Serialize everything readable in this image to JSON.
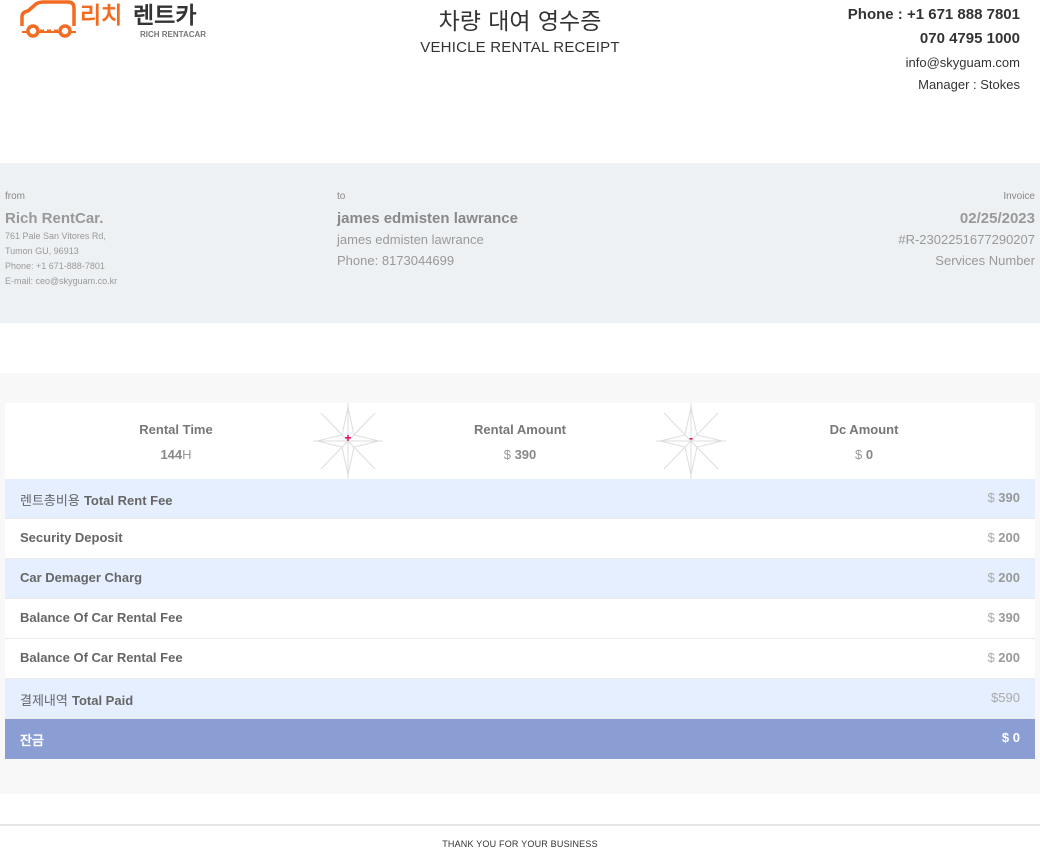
{
  "header": {
    "logo_text": "리치렌트카",
    "logo_subtext": "RICH RENTACAR",
    "title_ko": "차량 대여 영수증",
    "title_en": "VEHICLE RENTAL RECEIPT",
    "phone": "Phone : +1 671 888 7801",
    "phone2": "070 4795 1000",
    "email": "info@skyguam.com",
    "manager": "Manager : Stokes"
  },
  "from": {
    "label": "from",
    "name": "Rich RentCar.",
    "address1": "761 Pale San Vitores Rd,",
    "address2": "Tumon GU, 96913",
    "phone": "Phone: +1 671-888-7801",
    "email": "E-mail: ceo@skyguam.co.kr"
  },
  "to": {
    "label": "to",
    "name": "james edmisten lawrance",
    "subname": "james edmisten lawrance",
    "phone": "Phone: 8173044699"
  },
  "invoice": {
    "label": "Invoice",
    "date": "02/25/2023",
    "number": "#R-2302251677290207",
    "services": "Services Number"
  },
  "summary": {
    "rental_time_label": "Rental Time",
    "rental_time_value": "144",
    "rental_time_unit": "H",
    "plus": "+",
    "rental_amount_label": "Rental Amount",
    "rental_amount_currency": "$",
    "rental_amount_value": "390",
    "minus": "-",
    "dc_amount_label": "Dc Amount",
    "dc_amount_currency": "$",
    "dc_amount_value": "0"
  },
  "rows": {
    "total_rent_fee": {
      "label_ko": "렌트총비용 ",
      "label": "Total Rent Fee",
      "currency": "$",
      "value": "390"
    },
    "security_deposit": {
      "label": "Security Deposit",
      "currency": "$",
      "value": "200"
    },
    "car_damage": {
      "label": "Car Demager Charg",
      "currency": "$",
      "value": "200"
    },
    "balance1": {
      "label": "Balance Of Car Rental Fee",
      "currency": "$",
      "value": "390"
    },
    "balance2": {
      "label": "Balance Of Car Rental Fee",
      "currency": "$",
      "value": "200"
    },
    "total_paid": {
      "label_ko": "결제내역 ",
      "label": "Total Paid",
      "value": "$590"
    },
    "balance_due": {
      "label_ko": "잔금",
      "value": "$ 0"
    }
  },
  "footer": "THANK YOU FOR YOUR BUSINESS",
  "colors": {
    "logo_orange": "#f26b21",
    "row_blue": "#e6efff",
    "total_row": "#8a9ed3",
    "operator": "#e0005a",
    "band": "#eef1f3"
  }
}
